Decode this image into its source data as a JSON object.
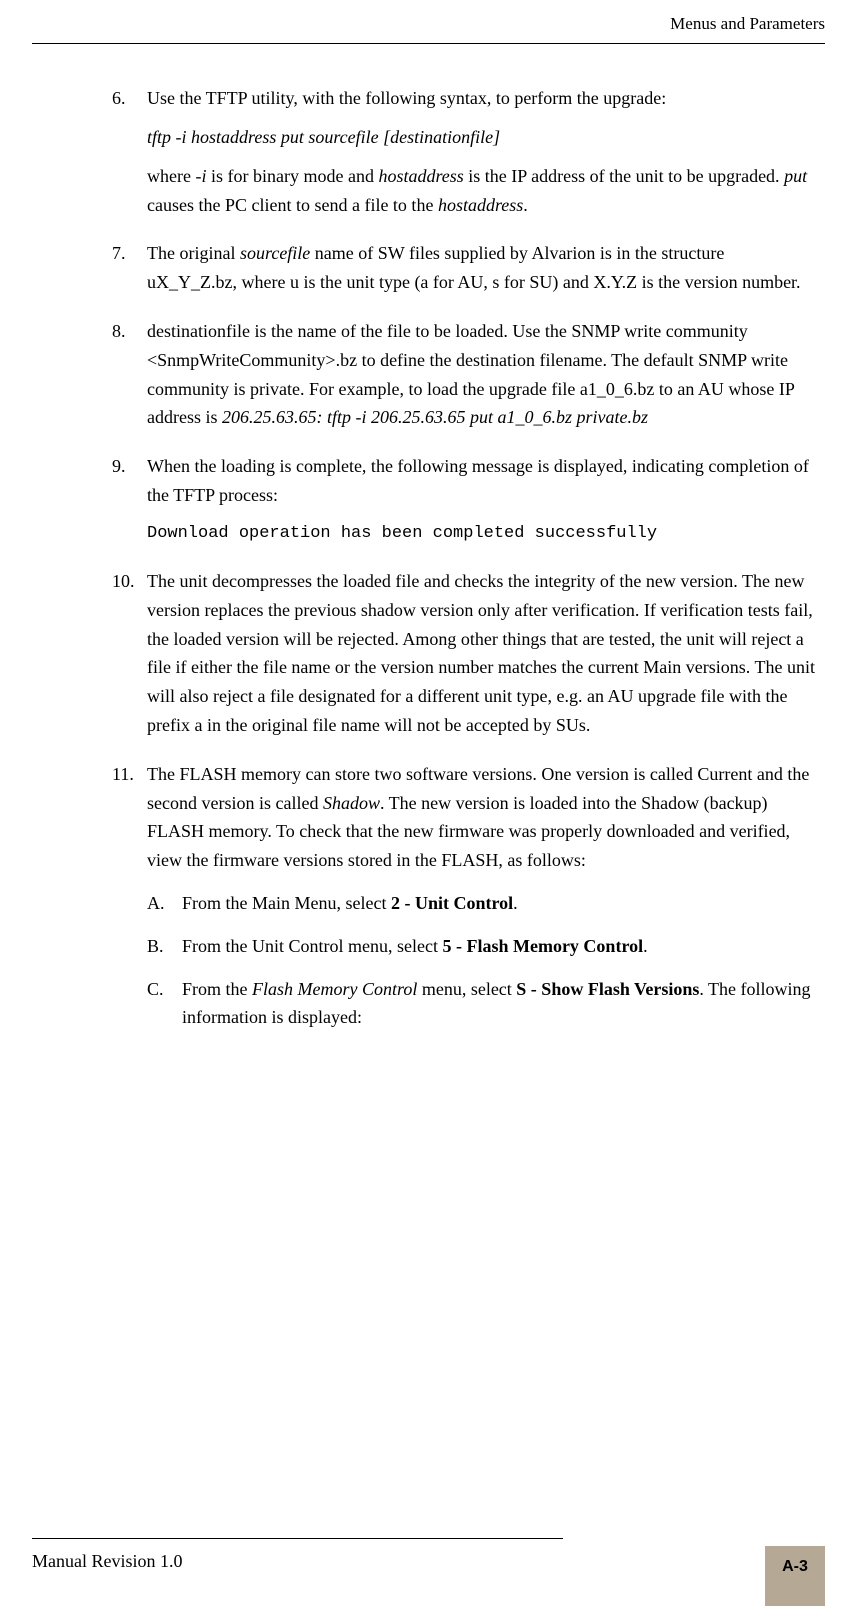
{
  "header": {
    "title": "Menus and Parameters"
  },
  "items": [
    {
      "number": "6.",
      "paragraphs": [
        {
          "type": "plain",
          "text": "Use the TFTP utility, with the following syntax, to perform the upgrade:"
        },
        {
          "type": "italic",
          "text": "tftp -i hostaddress put sourcefile [destinationfile]"
        },
        {
          "type": "mixed",
          "parts": [
            {
              "text": "where  ",
              "style": ""
            },
            {
              "text": "-i",
              "style": "italic"
            },
            {
              "text": " is for binary mode and ",
              "style": ""
            },
            {
              "text": "hostaddress",
              "style": "italic"
            },
            {
              "text": " is the IP address of the unit to be upgraded. ",
              "style": ""
            },
            {
              "text": "put",
              "style": "italic"
            },
            {
              "text": " causes the PC client to send a file to the ",
              "style": ""
            },
            {
              "text": "hostaddress",
              "style": "italic"
            },
            {
              "text": ".",
              "style": ""
            }
          ]
        }
      ]
    },
    {
      "number": "7.",
      "paragraphs": [
        {
          "type": "mixed",
          "parts": [
            {
              "text": "The original ",
              "style": ""
            },
            {
              "text": "sourcefile",
              "style": "italic"
            },
            {
              "text": " name of SW files supplied by Alvarion is in the structure uX_Y_Z.bz, where u is the unit type (a for AU, s for SU) and X.Y.Z is the version number.",
              "style": ""
            }
          ]
        }
      ]
    },
    {
      "number": "8.",
      "paragraphs": [
        {
          "type": "mixed",
          "parts": [
            {
              "text": "destinationfile is the name of the file to be loaded. Use the SNMP write community <SnmpWriteCommunity>.bz to define the destination filename. The default SNMP write community is private. For example, to load the upgrade file a1_0_6.bz to an AU whose IP address is ",
              "style": ""
            },
            {
              "text": "206.25.63.65: tftp -i 206.25.63.65 put a1_0_6.bz private.bz",
              "style": "italic"
            }
          ]
        }
      ]
    },
    {
      "number": "9.",
      "paragraphs": [
        {
          "type": "plain",
          "text": "When the loading is complete, the following message is displayed, indicating completion of the TFTP process:"
        },
        {
          "type": "code",
          "text": "Download operation has been completed successfully"
        }
      ]
    },
    {
      "number": "10.",
      "paragraphs": [
        {
          "type": "plain",
          "text": "The unit decompresses the loaded file and checks the integrity of the new version. The new version replaces the previous shadow version only after verification. If verification tests fail, the loaded version will be rejected. Among other things that are tested, the unit will reject a file if either the file name or the version number matches the current Main versions. The unit will also reject a file designated for a different unit type, e.g. an AU upgrade file with the prefix a in the original file name will not be accepted by SUs."
        }
      ]
    },
    {
      "number": "11.",
      "paragraphs": [
        {
          "type": "mixed",
          "parts": [
            {
              "text": "The FLASH memory can store two software versions. One version is called Current and the second version is called ",
              "style": ""
            },
            {
              "text": "Shadow",
              "style": "italic"
            },
            {
              "text": ". The new version is loaded into the Shadow (backup) FLASH memory. To check that the new firmware was properly downloaded and verified, view the firmware versions stored in the FLASH, as follows:",
              "style": ""
            }
          ]
        }
      ],
      "sublist": [
        {
          "letter": "A.",
          "parts": [
            {
              "text": "From the Main Menu, select ",
              "style": ""
            },
            {
              "text": "2 - Unit Control",
              "style": "bold"
            },
            {
              "text": ".",
              "style": ""
            }
          ]
        },
        {
          "letter": "B.",
          "parts": [
            {
              "text": "From the Unit Control menu, select ",
              "style": ""
            },
            {
              "text": "5 - Flash Memory Control",
              "style": "bold"
            },
            {
              "text": ".",
              "style": ""
            }
          ]
        },
        {
          "letter": "C.",
          "parts": [
            {
              "text": "From the ",
              "style": ""
            },
            {
              "text": "Flash Memory Control",
              "style": "italic"
            },
            {
              "text": " menu, select ",
              "style": ""
            },
            {
              "text": "S - Show Flash Versions",
              "style": "bold"
            },
            {
              "text": ". The following information is displayed:",
              "style": ""
            }
          ]
        }
      ]
    }
  ],
  "footer": {
    "revision": "Manual Revision 1.0",
    "pageNumber": "A-3"
  }
}
